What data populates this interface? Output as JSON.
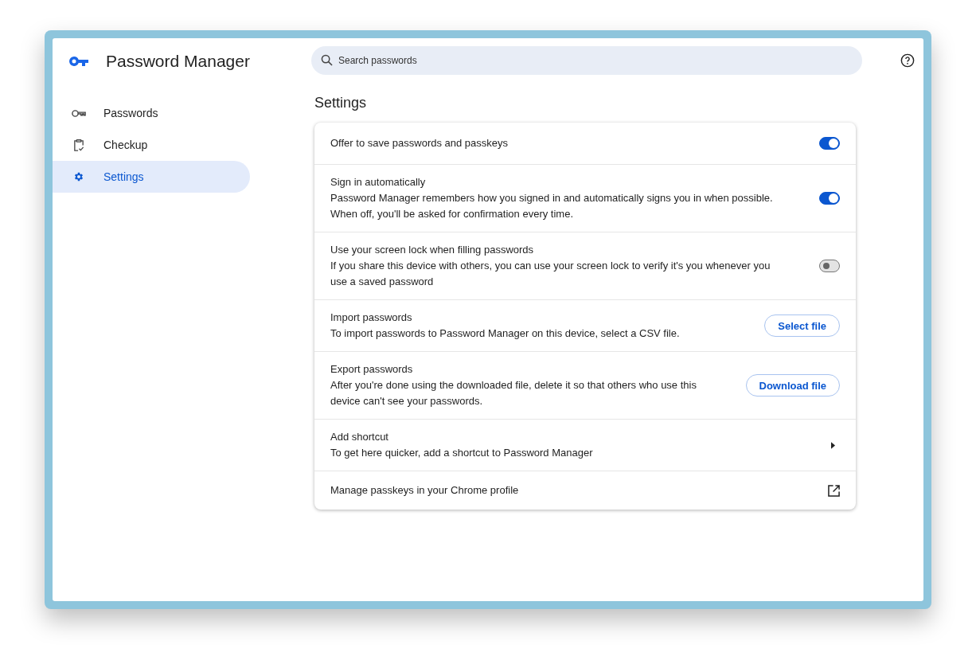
{
  "app": {
    "title": "Password Manager"
  },
  "search": {
    "placeholder": "Search passwords"
  },
  "sidebar": {
    "items": [
      {
        "label": "Passwords",
        "kind": "key",
        "selected": false
      },
      {
        "label": "Checkup",
        "kind": "checkup",
        "selected": false
      },
      {
        "label": "Settings",
        "kind": "gear",
        "selected": true
      }
    ]
  },
  "page": {
    "title": "Settings"
  },
  "settings": [
    {
      "kind": "toggle",
      "title": "Offer to save passwords and passkeys",
      "on": true
    },
    {
      "kind": "toggle",
      "title": "Sign in automatically",
      "description": "Password Manager remembers how you signed in and automatically signs you in when possible. When off, you'll be asked for confirmation every time.",
      "on": true
    },
    {
      "kind": "toggle",
      "title": "Use your screen lock when filling passwords",
      "description": "If you share this device with others, you can use your screen lock to verify it's you whenever you use a saved password",
      "on": false
    },
    {
      "kind": "button",
      "title": "Import passwords",
      "description": "To import passwords to Password Manager on this device, select a CSV file.",
      "button": "Select file"
    },
    {
      "kind": "button",
      "title": "Export passwords",
      "description": "After you're done using the downloaded file, delete it so that others who use this device can't see your passwords.",
      "button": "Download file"
    },
    {
      "kind": "submenu",
      "title": "Add shortcut",
      "description": "To get here quicker, add a shortcut to Password Manager"
    },
    {
      "kind": "external",
      "title": "Manage passkeys in your Chrome profile"
    }
  ]
}
